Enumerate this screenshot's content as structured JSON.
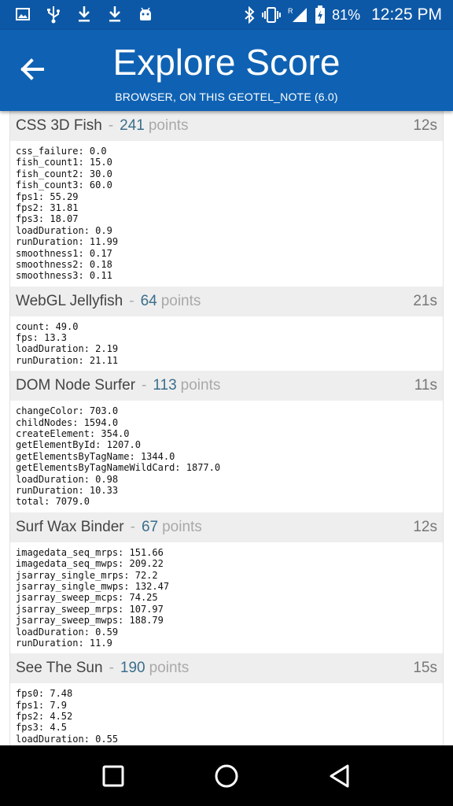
{
  "status_bar": {
    "left_icons": [
      "image-icon",
      "usb-icon",
      "download-icon",
      "download-icon",
      "android-icon"
    ],
    "battery_percent": "81%",
    "time": "12:25 PM"
  },
  "header": {
    "title": "Explore Score",
    "subtitle": "BROWSER, ON THIS GEOTEL_NOTE (6.0)"
  },
  "points_word": "points",
  "benchmarks": [
    {
      "name": "CSS 3D Fish",
      "score": "241",
      "duration": "12s",
      "metrics": [
        "css_failure: 0.0",
        "fish_count1: 15.0",
        "fish_count2: 30.0",
        "fish_count3: 60.0",
        "fps1: 55.29",
        "fps2: 31.81",
        "fps3: 18.07",
        "loadDuration: 0.9",
        "runDuration: 11.99",
        "smoothness1: 0.17",
        "smoothness2: 0.18",
        "smoothness3: 0.11"
      ]
    },
    {
      "name": "WebGL Jellyfish",
      "score": "64",
      "duration": "21s",
      "metrics": [
        "count: 49.0",
        "fps: 13.3",
        "loadDuration: 2.19",
        "runDuration: 21.11"
      ]
    },
    {
      "name": "DOM Node Surfer",
      "score": "113",
      "duration": "11s",
      "metrics": [
        "changeColor: 703.0",
        "childNodes: 1594.0",
        "createElement: 354.0",
        "getElementById: 1207.0",
        "getElementsByTagName: 1344.0",
        "getElementsByTagNameWildCard: 1877.0",
        "loadDuration: 0.98",
        "runDuration: 10.33",
        "total: 7079.0"
      ]
    },
    {
      "name": "Surf Wax Binder",
      "score": "67",
      "duration": "12s",
      "metrics": [
        "imagedata_seq_mrps: 151.66",
        "imagedata_seq_mwps: 209.22",
        "jsarray_single_mrps: 72.2",
        "jsarray_single_mwps: 132.47",
        "jsarray_sweep_mcps: 74.25",
        "jsarray_sweep_mrps: 107.97",
        "jsarray_sweep_mwps: 188.79",
        "loadDuration: 0.59",
        "runDuration: 11.9"
      ]
    },
    {
      "name": "See The Sun",
      "score": "190",
      "duration": "15s",
      "metrics": [
        "fps0: 7.48",
        "fps1: 7.9",
        "fps2: 4.52",
        "fps3: 4.5",
        "loadDuration: 0.55"
      ]
    }
  ],
  "nav_bar": [
    "recents-icon",
    "home-icon",
    "back-icon"
  ]
}
